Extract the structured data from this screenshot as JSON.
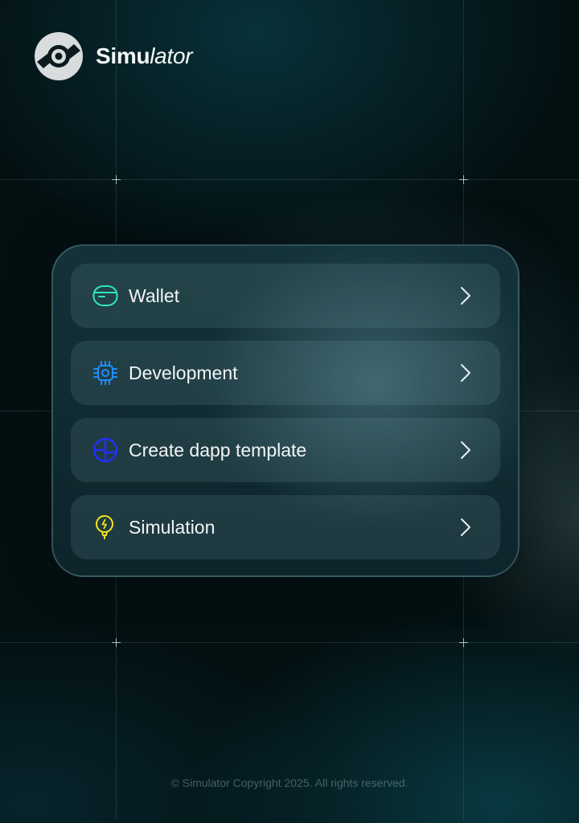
{
  "brand": {
    "name_bold": "Simu",
    "name_light": "lator",
    "logo_icon": "simulator-logo-icon"
  },
  "menu": {
    "items": [
      {
        "label": "Wallet",
        "icon": "wallet-icon",
        "color": "#2ee6b8"
      },
      {
        "label": "Development",
        "icon": "chip-icon",
        "color": "#1e8fff"
      },
      {
        "label": "Create dapp template",
        "icon": "template-icon",
        "color": "#2230ff"
      },
      {
        "label": "Simulation",
        "icon": "bulb-icon",
        "color": "#f2e21b"
      }
    ],
    "chevron_icon": "chevron-right-icon"
  },
  "footer": {
    "text": "© Simulator Copyright 2025. All rights reserved."
  }
}
